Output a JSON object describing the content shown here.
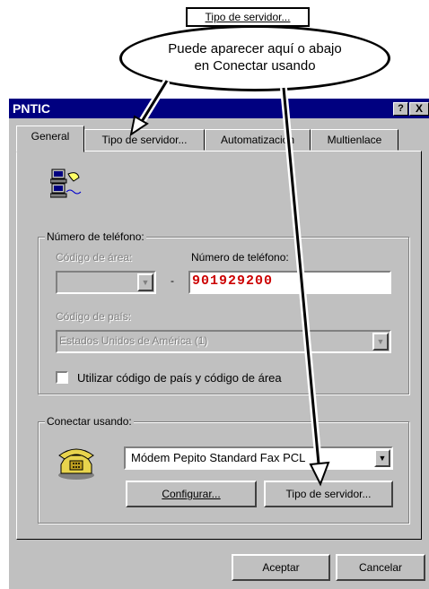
{
  "callout": {
    "tag": "Tipo de servidor...",
    "bubble_line1": "Puede aparecer aquí o abajo",
    "bubble_line2": "en Conectar usando"
  },
  "window": {
    "title": "PNTIC",
    "help": "?",
    "close": "X"
  },
  "tabs": [
    {
      "label": "General"
    },
    {
      "label": "Tipo de servidor..."
    },
    {
      "label": "Automatización"
    },
    {
      "label": "Multienlace"
    }
  ],
  "phone_group": {
    "legend": "Número de teléfono:",
    "area_code_label": "Código de área:",
    "area_code_value": "",
    "separator": "-",
    "phone_label": "Número de teléfono:",
    "phone_value": "901929200",
    "country_label": "Código de país:",
    "country_value": "Estados Unidos de América (1)",
    "use_codes_label": "Utilizar código de país y código de área"
  },
  "connect_group": {
    "legend": "Conectar usando:",
    "modem_value": "Módem Pepito Standard Fax PCL",
    "configure_label": "Configurar...",
    "server_type_label": "Tipo de servidor..."
  },
  "footer": {
    "ok_label": "Aceptar",
    "cancel_label": "Cancelar"
  },
  "colors": {
    "title_bar": "#000080",
    "dialog_bg": "#c0c0c0",
    "phone_text": "#cc0000"
  },
  "icons": [
    "network-computers-icon",
    "telephone-icon",
    "dropdown-arrow-icon"
  ]
}
